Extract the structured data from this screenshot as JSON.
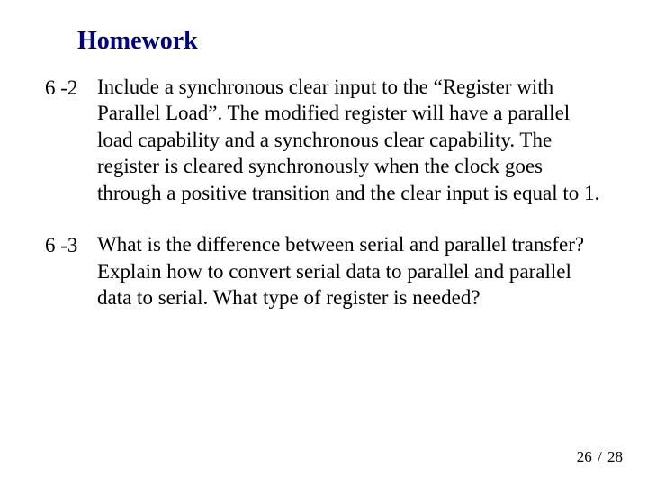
{
  "title": "Homework",
  "items": [
    {
      "number": "6 -2",
      "text": "Include a synchronous clear input to the “Register with Parallel Load”. The modified register will have a parallel load capability and a synchronous clear capability. The register is cleared synchronously when the clock goes through a positive transition and the clear input is equal to 1."
    },
    {
      "number": "6 -3",
      "text": "What is the difference between serial and parallel transfer? Explain how to convert serial data to parallel and parallel data to serial. What type of register is needed?"
    }
  ],
  "pager": {
    "current": "26",
    "separator": "/",
    "total": "28"
  }
}
